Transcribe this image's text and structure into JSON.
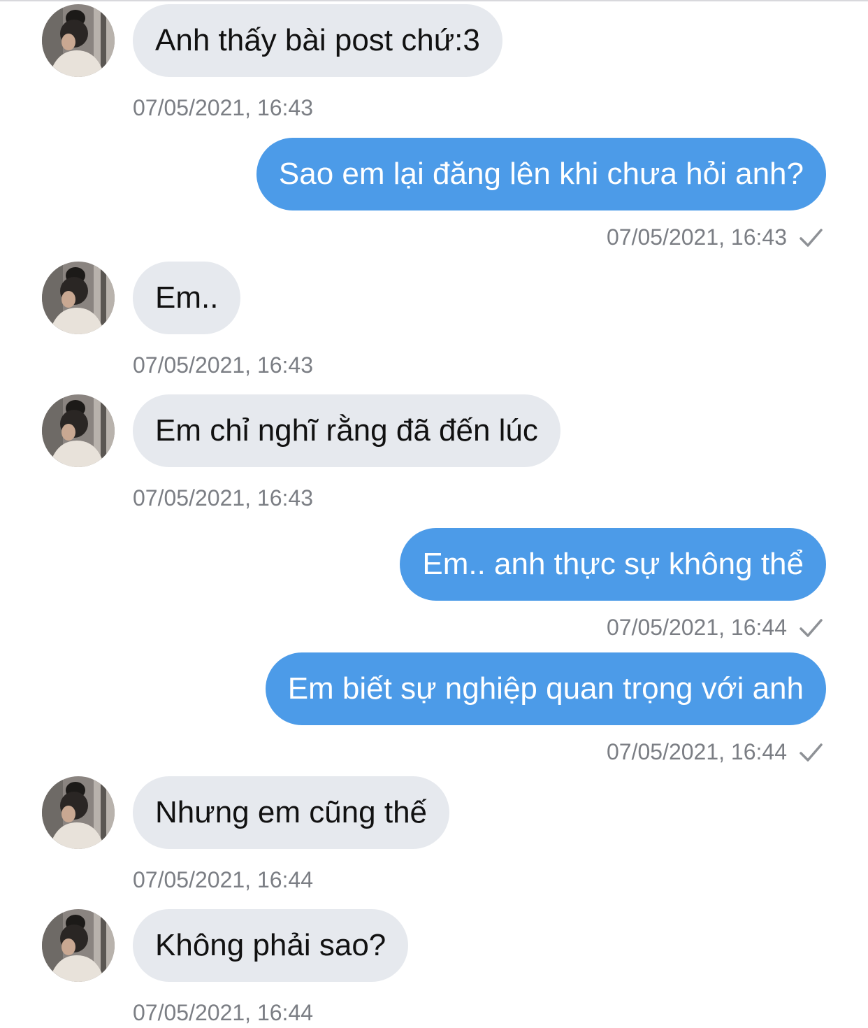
{
  "messages": [
    {
      "direction": "in",
      "text": "Anh thấy bài post chứ:3",
      "timestamp": "07/05/2021, 16:43"
    },
    {
      "direction": "out",
      "text": "Sao em lại đăng lên khi chưa hỏi anh?",
      "timestamp": "07/05/2021, 16:43",
      "status": "sent"
    },
    {
      "direction": "in",
      "text": "Em..",
      "timestamp": "07/05/2021, 16:43"
    },
    {
      "direction": "in",
      "text": "Em chỉ nghĩ rằng đã đến lúc",
      "timestamp": "07/05/2021, 16:43"
    },
    {
      "direction": "out",
      "text": "Em.. anh thực sự không thể",
      "timestamp": "07/05/2021, 16:44",
      "status": "sent"
    },
    {
      "direction": "out",
      "text": "Em biết sự nghiệp quan trọng với anh",
      "timestamp": "07/05/2021, 16:44",
      "status": "sent"
    },
    {
      "direction": "in",
      "text": "Nhưng em cũng thế",
      "timestamp": "07/05/2021, 16:44"
    },
    {
      "direction": "in",
      "text": "Không phải sao?",
      "timestamp": "07/05/2021, 16:44"
    }
  ],
  "colors": {
    "incoming_bubble": "#e6e9ee",
    "outgoing_bubble": "#4c9be8",
    "timestamp_text": "#7b7e84",
    "check_mark": "#8e9196"
  },
  "icons": {
    "avatar": "contact-avatar-photo",
    "sent_status": "checkmark-icon"
  }
}
